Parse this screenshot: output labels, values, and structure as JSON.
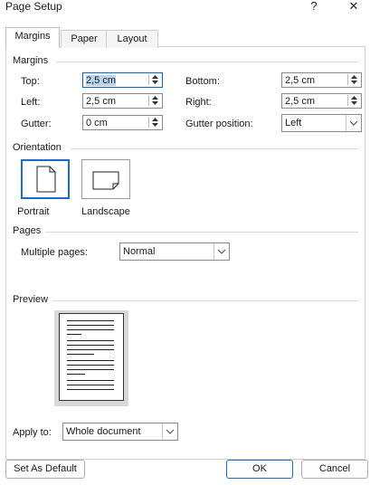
{
  "window": {
    "title": "Page Setup",
    "help": "?",
    "close": "✕"
  },
  "tabs": [
    "Margins",
    "Paper",
    "Layout"
  ],
  "margins": {
    "section": "Margins",
    "top": {
      "label": "Top:",
      "value": "2,5 cm"
    },
    "bottom": {
      "label": "Bottom:",
      "value": "2,5 cm"
    },
    "left": {
      "label": "Left:",
      "value": "2,5 cm"
    },
    "right": {
      "label": "Right:",
      "value": "2,5 cm"
    },
    "gutter": {
      "label": "Gutter:",
      "value": "0 cm"
    },
    "gutter_position": {
      "label": "Gutter position:",
      "value": "Left"
    }
  },
  "orientation": {
    "section": "Orientation",
    "portrait": "Portrait",
    "landscape": "Landscape",
    "selected": "Portrait"
  },
  "pages": {
    "section": "Pages",
    "multiple_label": "Multiple pages:",
    "multiple_value": "Normal"
  },
  "preview": {
    "section": "Preview"
  },
  "apply": {
    "label": "Apply to:",
    "value": "Whole document"
  },
  "buttons": {
    "default": "Set As Default",
    "ok": "OK",
    "cancel": "Cancel"
  },
  "colors": {
    "accent": "#1a6cc8",
    "selection": "#b8d4f0"
  }
}
